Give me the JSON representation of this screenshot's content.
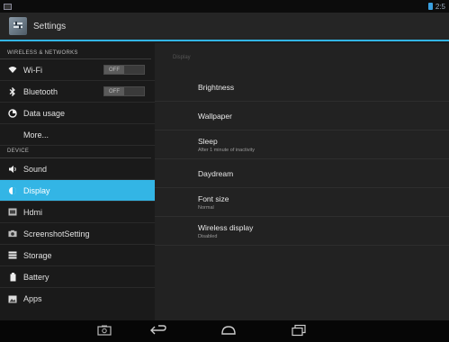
{
  "statusbar": {
    "time": "2:5"
  },
  "actionbar": {
    "title": "Settings"
  },
  "sections": [
    {
      "header": "WIRELESS & NETWORKS",
      "items": [
        {
          "label": "Wi-Fi",
          "icon": "wifi-icon",
          "toggle": "OFF"
        },
        {
          "label": "Bluetooth",
          "icon": "bluetooth-icon",
          "toggle": "OFF"
        },
        {
          "label": "Data usage",
          "icon": "data-usage-icon"
        },
        {
          "label": "More..."
        }
      ]
    },
    {
      "header": "DEVICE",
      "items": [
        {
          "label": "Sound",
          "icon": "sound-icon"
        },
        {
          "label": "Display",
          "icon": "display-icon",
          "active": true
        },
        {
          "label": "Hdmi",
          "icon": "hdmi-icon"
        },
        {
          "label": "ScreenshotSetting",
          "icon": "screenshot-icon"
        },
        {
          "label": "Storage",
          "icon": "storage-icon"
        },
        {
          "label": "Battery",
          "icon": "battery-icon"
        },
        {
          "label": "Apps",
          "icon": "apps-icon"
        }
      ]
    }
  ],
  "detail": {
    "header": "Display",
    "settings": [
      {
        "title": "Brightness"
      },
      {
        "title": "Wallpaper"
      },
      {
        "title": "Sleep",
        "sub": "After 1 minute of inactivity"
      },
      {
        "title": "Daydream"
      },
      {
        "title": "Font size",
        "sub": "Normal"
      },
      {
        "title": "Wireless display",
        "sub": "Disabled"
      }
    ]
  },
  "colors": {
    "accent": "#33b5e5",
    "background": "#1c1c1c"
  }
}
